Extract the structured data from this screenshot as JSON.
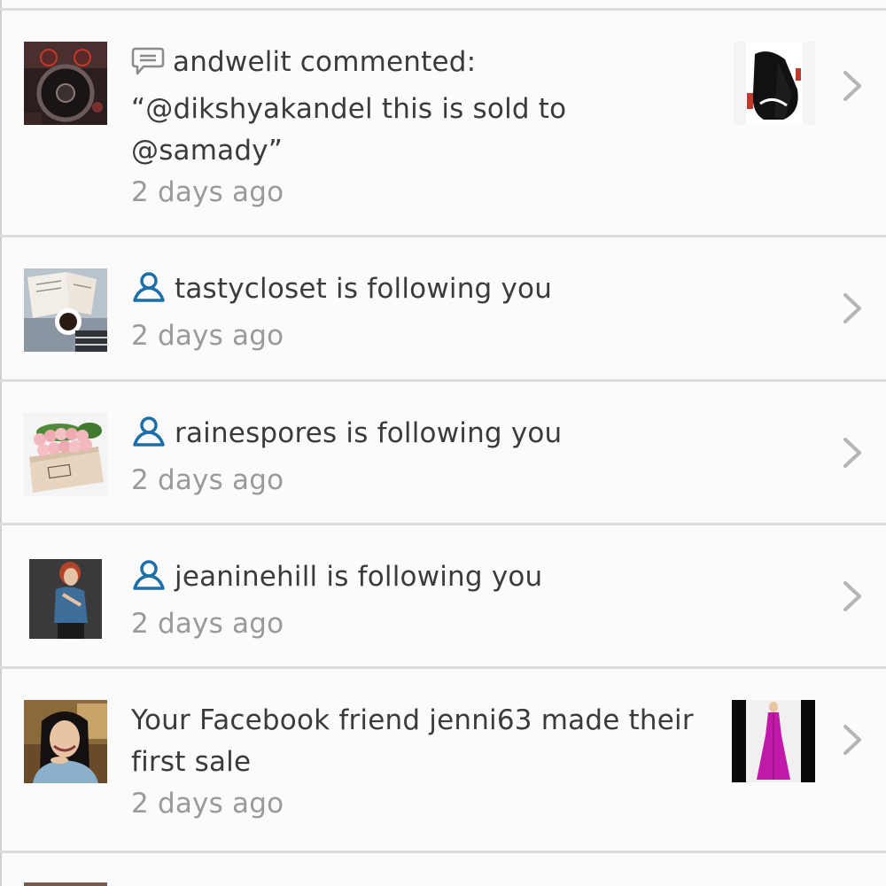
{
  "notifications": [
    {
      "user": "andwelit",
      "type": "comment",
      "icon": "comment-bubble-icon",
      "lines": [
        "andwelit commented:",
        "“@dikshyakandel this is sold to",
        "@samady”"
      ],
      "time": "2 days ago",
      "has_thumbnail": true
    },
    {
      "user": "tastycloset",
      "type": "follow",
      "icon": "person-follow-icon",
      "lines": [
        "tastycloset is following you"
      ],
      "time": "2 days ago",
      "has_thumbnail": false
    },
    {
      "user": "rainespores",
      "type": "follow",
      "icon": "person-follow-icon",
      "lines": [
        "rainespores is following you"
      ],
      "time": "2 days ago",
      "has_thumbnail": false
    },
    {
      "user": "jeaninehill",
      "type": "follow",
      "icon": "person-follow-icon",
      "lines": [
        "jeaninehill is following you"
      ],
      "time": "2 days ago",
      "has_thumbnail": false
    },
    {
      "user": "jenni63",
      "type": "sale",
      "icon": "",
      "lines": [
        "Your Facebook friend jenni63 made their",
        "first sale"
      ],
      "time": "2 days ago",
      "has_thumbnail": true
    }
  ],
  "colors": {
    "follow_icon": "#1c6fa8",
    "comment_icon": "#8a8a8a",
    "time_text": "#9a9a9a",
    "divider": "#dcdcdc",
    "chevron": "#b5b5b5"
  }
}
